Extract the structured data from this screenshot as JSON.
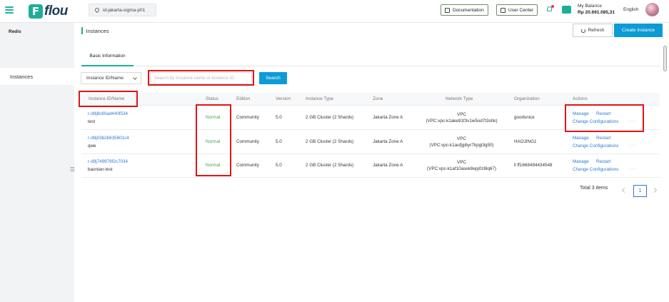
{
  "header": {
    "logo_letter": "F",
    "logo_text": "flou",
    "region": "id-jakarta-sigma-p01",
    "documentation": "Documentation",
    "user_center": "User Center",
    "balance_label": "My Balance",
    "balance_value": "Rp 20.691.085,31",
    "language": "English"
  },
  "sidebar": {
    "title": "Redis",
    "items": [
      {
        "label": "Instances"
      }
    ],
    "handle": "☰"
  },
  "main": {
    "page_title": "Instances",
    "refresh_label": "Refresh",
    "create_label": "Create Instance",
    "tabs": [
      {
        "label": "Basic Information"
      }
    ],
    "filter_select": "Instance ID/Name",
    "search_placeholder": "Search by Instance name or instance ID",
    "search_label": "Search"
  },
  "table": {
    "columns": [
      "Instance ID/Name",
      "Status",
      "Edition",
      "Version",
      "Instance Type",
      "Zone",
      "Network Type",
      "Organization",
      "Actions"
    ],
    "rows": [
      {
        "id": "r-d9j8c80ad440f534",
        "name": "test",
        "status": "Normal",
        "edition": "Community",
        "version": "5.0",
        "type": "2 GB Cluster (2 Shards)",
        "zone": "Jakarta Zone A",
        "network": "VPC",
        "vpc": "(VPC:vpc-k1ake91f3v1w5od7t3shk)",
        "org": "goodsnice",
        "actions": [
          "Manage",
          "Restart",
          "Change Configurations"
        ],
        "more": "···"
      },
      {
        "id": "r-d9j03b2b635601c4",
        "name": "qwe",
        "status": "Normal",
        "edition": "Community",
        "version": "5.0",
        "type": "2 GB Cluster (2 Shards)",
        "zone": "Jakarta Zone A",
        "network": "VPC",
        "vpc": "(VPC:vpc-k1aufjgibyr7kpgl3g50)",
        "org": "HAOJING1",
        "actions": [
          "Manage",
          "Restart",
          "Change Configurations"
        ],
        "more": "···"
      },
      {
        "id": "r-d9j749978f2c7034",
        "name": "baonian-test",
        "status": "Normal",
        "edition": "Community",
        "version": "5.0",
        "type": "2 GB Cluster (2 Shards)",
        "zone": "Jakarta Zone A",
        "network": "VPC",
        "vpc": "(VPC:vpc-k1af10asek8epj0z8lq67)",
        "org": "ll ff1668494434548",
        "actions": [
          "Manage",
          "Restart",
          "Change Configurations"
        ],
        "more": "···"
      }
    ]
  },
  "pagination": {
    "total": "Total 3 items",
    "current": "1"
  },
  "colors": {
    "brand": "#1eae98",
    "primary": "#0d9bd6",
    "link": "#2a79d4",
    "status_ok": "#3ea74a",
    "highlight": "#e21414"
  }
}
